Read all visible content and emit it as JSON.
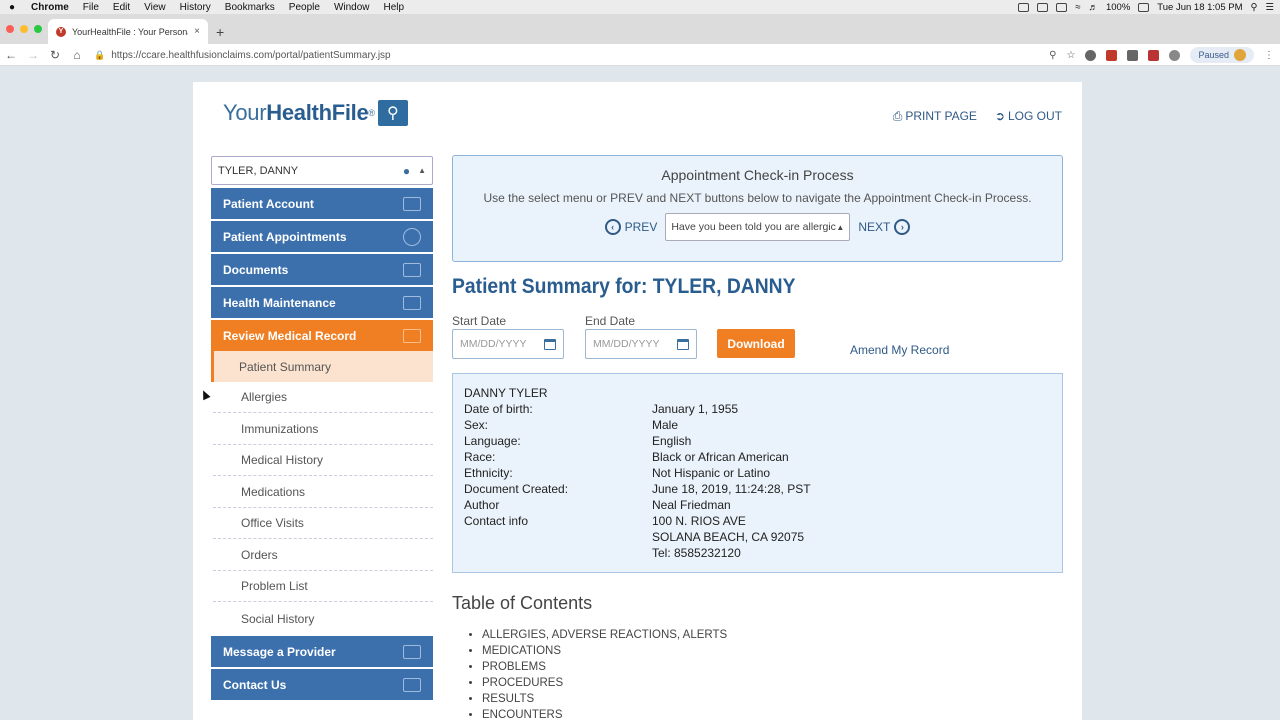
{
  "os_menu": {
    "apple": "",
    "items": [
      "Chrome",
      "File",
      "Edit",
      "View",
      "History",
      "Bookmarks",
      "People",
      "Window",
      "Help"
    ],
    "battery": "100%",
    "clock": "Tue Jun 18  1:05 PM"
  },
  "browser": {
    "tab_title": "YourHealthFile : Your Personal",
    "tab_close": "×",
    "new_tab": "+",
    "url": "https://ccare.healthfusionclaims.com/portal/patientSummary.jsp",
    "profile_status": "Paused"
  },
  "header": {
    "logo_light": "Your",
    "logo_bold": "HealthFile",
    "logo_reg": "®",
    "print_label": "PRINT PAGE",
    "logout_label": "LOG OUT"
  },
  "sidebar": {
    "patient_selected": "TYLER, DANNY",
    "items": [
      {
        "label": "Patient Account"
      },
      {
        "label": "Patient Appointments"
      },
      {
        "label": "Documents"
      },
      {
        "label": "Health Maintenance"
      },
      {
        "label": "Review Medical Record"
      }
    ],
    "subitems": [
      "Patient Summary",
      "Allergies",
      "Immunizations",
      "Medical History",
      "Medications",
      "Office Visits",
      "Orders",
      "Problem List",
      "Social History"
    ],
    "bottom_items": [
      {
        "label": "Message a Provider"
      },
      {
        "label": "Contact Us"
      }
    ]
  },
  "checkin": {
    "title": "Appointment Check-in Process",
    "description": "Use the select menu or PREV and NEXT buttons below to navigate the Appointment Check-in Process.",
    "prev_label": "PREV",
    "next_label": "NEXT",
    "select_value": "Have you been told you are allergic"
  },
  "summary": {
    "title": "Patient Summary for: TYLER, DANNY",
    "start_label": "Start Date",
    "end_label": "End Date",
    "start_placeholder": "MM/DD/YYYY",
    "end_placeholder": "MM/DD/YYYY",
    "download_label": "Download",
    "amend_label": "Amend My Record"
  },
  "patient_info": {
    "name": "DANNY TYLER",
    "rows": [
      {
        "k": "Date of birth:",
        "v": "January 1, 1955"
      },
      {
        "k": "Sex:",
        "v": "Male"
      },
      {
        "k": "Language:",
        "v": "English"
      },
      {
        "k": "Race:",
        "v": "Black or African American"
      },
      {
        "k": "Ethnicity:",
        "v": "Not Hispanic or Latino"
      },
      {
        "k": "Document Created:",
        "v": "June 18, 2019, 11:24:28, PST"
      },
      {
        "k": "Author",
        "v": "Neal Friedman"
      },
      {
        "k": "Contact info",
        "v": "100 N. RIOS AVE"
      },
      {
        "k": "",
        "v": "SOLANA BEACH, CA 92075"
      },
      {
        "k": "",
        "v": "Tel: 8585232120"
      }
    ]
  },
  "toc": {
    "title": "Table of Contents",
    "items": [
      "ALLERGIES, ADVERSE REACTIONS, ALERTS",
      "MEDICATIONS",
      "PROBLEMS",
      "PROCEDURES",
      "RESULTS",
      "ENCOUNTERS"
    ]
  }
}
